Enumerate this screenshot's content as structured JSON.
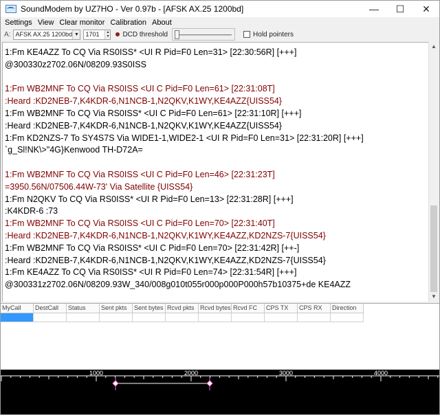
{
  "window": {
    "title": "SoundModem by UZ7HO - Ver 0.97b - [AFSK AX.25 1200bd]",
    "controls": {
      "minimize": "—",
      "maximize": "☐",
      "close": "✕"
    }
  },
  "menu": [
    "Settings",
    "View",
    "Clear monitor",
    "Calibration",
    "About"
  ],
  "toolbar": {
    "channel_label": "A:",
    "mode_value": "AFSK AX.25 1200bd",
    "freq_value": "1701",
    "dcd_label": "DCD threshold",
    "hold_label": "Hold pointers",
    "hold_checked": false
  },
  "log": [
    {
      "text": "1:Fm KE4AZZ To CQ Via RS0ISS* <UI R Pid=F0 Len=31> [22:30:56R] [+++]",
      "kind": "rx"
    },
    {
      "text": "@300330z2702.06N/08209.93S0ISS",
      "kind": "rx"
    },
    {
      "text": "",
      "kind": "rx"
    },
    {
      "text": "1:Fm WB2MNF To CQ Via RS0ISS <UI C Pid=F0 Len=61> [22:31:08T]",
      "kind": "tx"
    },
    {
      "text": ":Heard    :KD2NEB-7,K4KDR-6,N1NCB-1,N2QKV,K1WY,KE4AZZ{UISS54}",
      "kind": "tx"
    },
    {
      "text": "1:Fm WB2MNF To CQ Via RS0ISS* <UI C Pid=F0 Len=61> [22:31:10R] [+++]",
      "kind": "rx"
    },
    {
      "text": ":Heard    :KD2NEB-7,K4KDR-6,N1NCB-1,N2QKV,K1WY,KE4AZZ{UISS54}",
      "kind": "rx"
    },
    {
      "text": "1:Fm KD2NZS-7 To SY4S7S Via WIDE1-1,WIDE2-1 <UI R Pid=F0 Len=31> [22:31:20R] [+++]",
      "kind": "rx"
    },
    {
      "text": "`g_Sl!NK\\>\"4G}Kenwood TH-D72A=",
      "kind": "rx"
    },
    {
      "text": "",
      "kind": "rx"
    },
    {
      "text": "1:Fm WB2MNF To CQ Via RS0ISS <UI C Pid=F0 Len=46> [22:31:23T]",
      "kind": "tx"
    },
    {
      "text": "=3950.56N/07506.44W-73' Via Satellite {UISS54}",
      "kind": "tx"
    },
    {
      "text": "1:Fm N2QKV To CQ Via RS0ISS* <UI R Pid=F0 Len=13> [22:31:28R] [+++]",
      "kind": "rx"
    },
    {
      "text": ":K4KDR-6  :73",
      "kind": "rx"
    },
    {
      "text": "1:Fm WB2MNF To CQ Via RS0ISS <UI C Pid=F0 Len=70> [22:31:40T]",
      "kind": "tx"
    },
    {
      "text": ":Heard    :KD2NEB-7,K4KDR-6,N1NCB-1,N2QKV,K1WY,KE4AZZ,KD2NZS-7{UISS54}",
      "kind": "tx"
    },
    {
      "text": "1:Fm WB2MNF To CQ Via RS0ISS* <UI C Pid=F0 Len=70> [22:31:42R] [++-]",
      "kind": "rx"
    },
    {
      "text": ":Heard    :KD2NEB-7,K4KDR-6,N1NCB-1,N2QKV,K1WY,KE4AZZ,KD2NZS-7{UISS54}",
      "kind": "rx"
    },
    {
      "text": "1:Fm KE4AZZ To CQ Via RS0ISS* <UI R Pid=F0 Len=74> [22:31:54R] [+++]",
      "kind": "rx"
    },
    {
      "text": "@300331z2702.06N/08209.93W_340/008g010t055r000p000P000h57b10375+de KE4AZZ",
      "kind": "rx"
    }
  ],
  "colors": {
    "rx": "#000000",
    "tx": "#800000",
    "selection": "#3399ff"
  },
  "table": {
    "columns": [
      "MyCall",
      "DestCall",
      "Status",
      "Sent pkts",
      "Sent bytes",
      "Rcvd pkts",
      "Rcvd bytes",
      "Rcvd FC",
      "CPS TX",
      "CPS RX",
      "Direction"
    ]
  },
  "waterfall": {
    "ticks": [
      "1000",
      "2000",
      "3000",
      "4000"
    ]
  }
}
